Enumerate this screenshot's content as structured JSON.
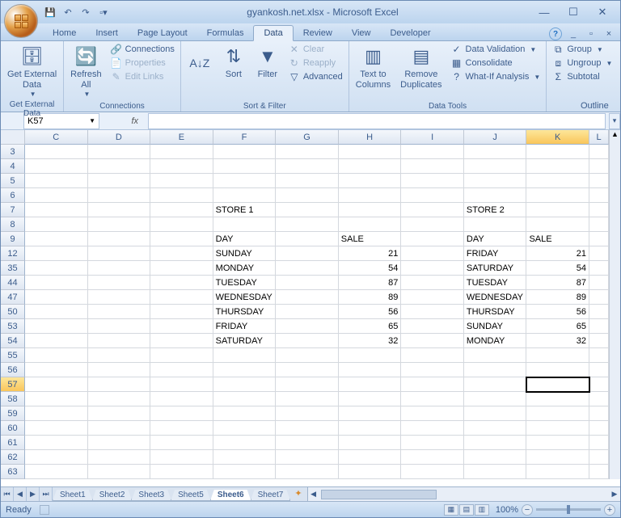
{
  "title": "gyankosh.net.xlsx - Microsoft Excel",
  "tabs": [
    "Home",
    "Insert",
    "Page Layout",
    "Formulas",
    "Data",
    "Review",
    "View",
    "Developer"
  ],
  "activeTab": "Data",
  "ribbon": {
    "g1": {
      "label": "Get External Data",
      "btn": "Get External\nData"
    },
    "g2": {
      "label": "Connections",
      "btn": "Refresh\nAll",
      "items": [
        "Connections",
        "Properties",
        "Edit Links"
      ]
    },
    "g3": {
      "label": "Sort & Filter",
      "sort": "Sort",
      "filter": "Filter",
      "items": [
        "Clear",
        "Reapply",
        "Advanced"
      ]
    },
    "g4": {
      "label": "Data Tools",
      "ttc": "Text to\nColumns",
      "rd": "Remove\nDuplicates",
      "items": [
        "Data Validation",
        "Consolidate",
        "What-If Analysis"
      ]
    },
    "g5": {
      "label": "Outline",
      "items": [
        "Group",
        "Ungroup",
        "Subtotal"
      ]
    }
  },
  "nameBox": "K57",
  "cols": [
    "C",
    "D",
    "E",
    "F",
    "G",
    "H",
    "I",
    "J",
    "K",
    "L"
  ],
  "activeCol": "K",
  "rows": [
    "3",
    "4",
    "5",
    "6",
    "7",
    "8",
    "9",
    "12",
    "35",
    "44",
    "47",
    "50",
    "53",
    "54",
    "55",
    "56",
    "57",
    "58",
    "59",
    "60",
    "61",
    "62",
    "63"
  ],
  "activeRow": "57",
  "cells": {
    "F7": "STORE 1",
    "J7": "STORE 2",
    "F9": "DAY",
    "H9": "SALE",
    "J9": "DAY",
    "K9": "SALE",
    "F12": "SUNDAY",
    "H12": "21",
    "J12": "FRIDAY",
    "K12": "21",
    "F35": "MONDAY",
    "H35": "54",
    "J35": "SATURDAY",
    "K35": "54",
    "F44": "TUESDAY",
    "H44": "87",
    "J44": "TUESDAY",
    "K44": "87",
    "F47": "WEDNESDAY",
    "H47": "89",
    "J47": "WEDNESDAY",
    "K47": "89",
    "F50": "THURSDAY",
    "H50": "56",
    "J50": "THURSDAY",
    "K50": "56",
    "F53": "FRIDAY",
    "H53": "65",
    "J53": "SUNDAY",
    "K53": "65",
    "F54": "SATURDAY",
    "H54": "32",
    "J54": "MONDAY",
    "K54": "32"
  },
  "sheets": [
    "Sheet1",
    "Sheet2",
    "Sheet3",
    "Sheet5",
    "Sheet6",
    "Sheet7"
  ],
  "activeSheet": "Sheet6",
  "status": "Ready",
  "zoom": "100%"
}
